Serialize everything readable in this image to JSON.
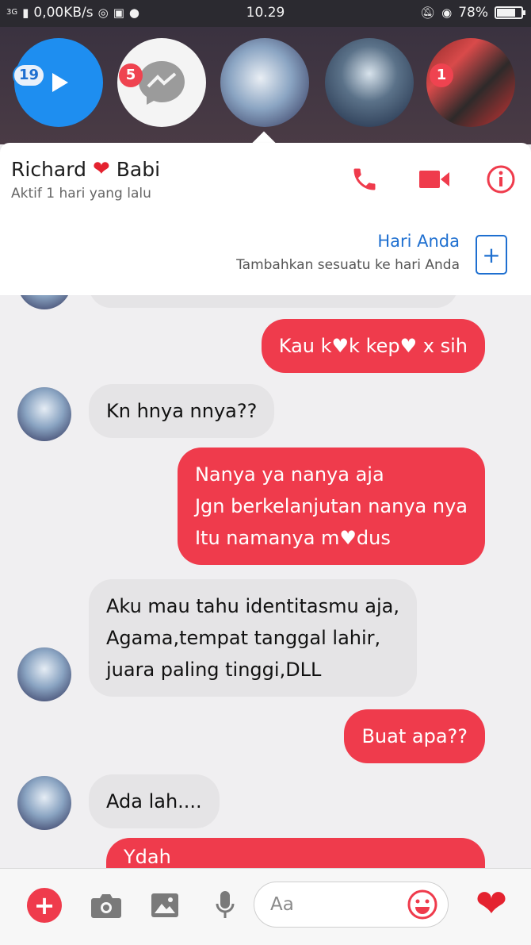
{
  "status_bar": {
    "network": "3G",
    "speed": "0,00KB/s",
    "time": "10.29",
    "battery": "78%",
    "battery_level": 0.78
  },
  "chat_heads": [
    {
      "kind": "video",
      "badge": "19"
    },
    {
      "kind": "messenger",
      "badge": "5"
    },
    {
      "kind": "photo",
      "badge": ""
    },
    {
      "kind": "photo",
      "badge": ""
    },
    {
      "kind": "photo",
      "badge": "1"
    }
  ],
  "header": {
    "name_first": "Richard",
    "name_heart": "❤",
    "name_last": "Babi",
    "status": "Aktif 1 hari yang lalu",
    "day_title": "Hari Anda",
    "day_subtitle": "Tambahkan sesuatu ke hari Anda"
  },
  "messages": [
    {
      "side": "out",
      "text": "Kau k♥k kep♥ x sih"
    },
    {
      "side": "in",
      "text": "Kn hnya nnya??"
    },
    {
      "side": "out",
      "text": "Nanya ya nanya aja\nJgn berkelanjutan nanya nya\nItu namanya m♥dus"
    },
    {
      "side": "in",
      "text": "Aku mau tahu identitasmu aja,\nAgama,tempat tanggal lahir,\njuara paling tinggi,DLL"
    },
    {
      "side": "out",
      "text": "Buat apa??"
    },
    {
      "side": "in",
      "text": "Ada lah...."
    },
    {
      "side": "out",
      "text": "Ydah"
    }
  ],
  "composer": {
    "placeholder": "Aa",
    "like": "❤"
  },
  "colors": {
    "accent_red": "#ef3b4c",
    "accent_blue": "#1e6fd0",
    "incoming_bubble": "#e5e4e6"
  },
  "icons": [
    "add-icon",
    "camera-icon",
    "gallery-icon",
    "microphone-icon",
    "emoji-icon",
    "heart-icon",
    "phone-icon",
    "video-call-icon",
    "info-icon"
  ]
}
